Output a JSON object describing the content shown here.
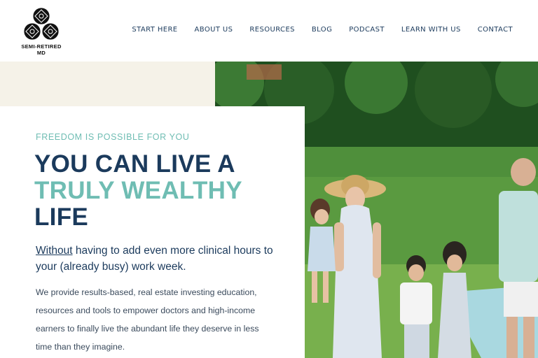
{
  "logo": {
    "line1": "SEMI-RETIRED",
    "line2": "MD",
    "icon": "lattice-logo-icon"
  },
  "nav": {
    "items": [
      {
        "label": "START HERE"
      },
      {
        "label": "ABOUT US"
      },
      {
        "label": "RESOURCES"
      },
      {
        "label": "BLOG"
      },
      {
        "label": "PODCAST"
      },
      {
        "label": "LEARN WITH US"
      },
      {
        "label": "CONTACT"
      }
    ]
  },
  "hero": {
    "eyebrow": "FREEDOM IS POSSIBLE FOR YOU",
    "headline_line1": "YOU CAN LIVE A",
    "headline_line2": "TRULY WEALTHY",
    "headline_line3": "LIFE",
    "sub_emphasis": "Without",
    "sub_rest": " having to add even more clinical hours to your (already busy) work week.",
    "body": "We provide results-based, real estate investing education, resources and tools to empower doctors and high-income earners to finally live the abundant life they deserve in less time than they imagine."
  },
  "colors": {
    "navy": "#1b3a5c",
    "teal": "#6fbdb3",
    "beige": "#f5f2e8"
  }
}
